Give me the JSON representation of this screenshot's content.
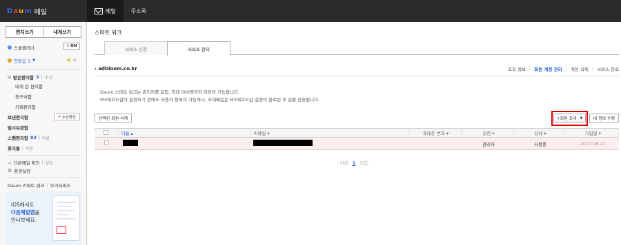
{
  "app": {
    "logo": "Daum",
    "logo_letters": [
      {
        "ch": "D",
        "color": "#3b64d6"
      },
      {
        "ch": "a",
        "color": "#e03a3a"
      },
      {
        "ch": "u",
        "color": "#f2b000"
      },
      {
        "ch": "m",
        "color": "#3b64d6"
      }
    ],
    "title": "메일"
  },
  "topnav": {
    "mail_label": "메일",
    "contacts_label": "주소록"
  },
  "sidebar": {
    "write_label": "편지쓰기",
    "self_write_label": "내게쓰기",
    "scheduler_label": "스쿨클러너",
    "toggle_label": "ON",
    "important_label": "안읽음 3",
    "inbox_label": "받은편지함",
    "inbox_count": "3",
    "inbox_extra": "추가",
    "folders": [
      "내게 쓴 편지함",
      "청구서함",
      "카페편지함"
    ],
    "sent_label": "보낸편지함",
    "receipt_label": "수신확인",
    "drafts_label": "임시보관함",
    "spam_label": "스팸편지함",
    "spam_count": "83",
    "spam_extra": "비움",
    "trash_label": "휴지통",
    "trash_extra": "비움",
    "other_mail_label": "다른메일 확인",
    "other_mail_extra": "설정",
    "settings_label": "환경설정",
    "links": [
      "Daum 스마트 워크",
      "부가서비스"
    ],
    "ad_line1": "iOS에서도",
    "ad_line2_highlight": "다음메일앱",
    "ad_line2_rest": "을",
    "ad_line3": "만나보세요."
  },
  "main": {
    "page_title": "스마트 워크",
    "tabs": [
      "서비스 신청",
      "서비스 관리"
    ],
    "domain": "adbloom.co.kr",
    "sublinks": [
      "조직 정보",
      "회원 계정 관리",
      "계정 삭제",
      "서비스 종료"
    ],
    "notice_line1": "Daum 스마트 워크는 관리자를 포함, 최대 500명까지 이용이 가능합니다.",
    "notice_line2": "MX레코드값이 설정되기 전에도 사용자 등록이 가능하나, 초대메일은 MX레코드값 설정이 완료된 후 일괄 전송됩니다.",
    "delete_selected_label": "선택된 회원 삭제",
    "invite_label": "+회원 초대",
    "edit_info_label": "내 정보 수정",
    "columns": [
      "이름",
      "이메일",
      "휴대폰 번호",
      "권한",
      "상태",
      "가입일"
    ],
    "rows": [
      {
        "name": "",
        "email": "",
        "phone": "",
        "role": "관리자",
        "status": "사용중",
        "joined": "2017.06.21"
      }
    ],
    "pager_prev": "‹ 이전",
    "pager_current": "1",
    "pager_next": "다음 ›"
  },
  "colors": {
    "accent": "#2a5fd8",
    "highlight_red": "#d00000",
    "topbar": "#2b2b2b"
  }
}
